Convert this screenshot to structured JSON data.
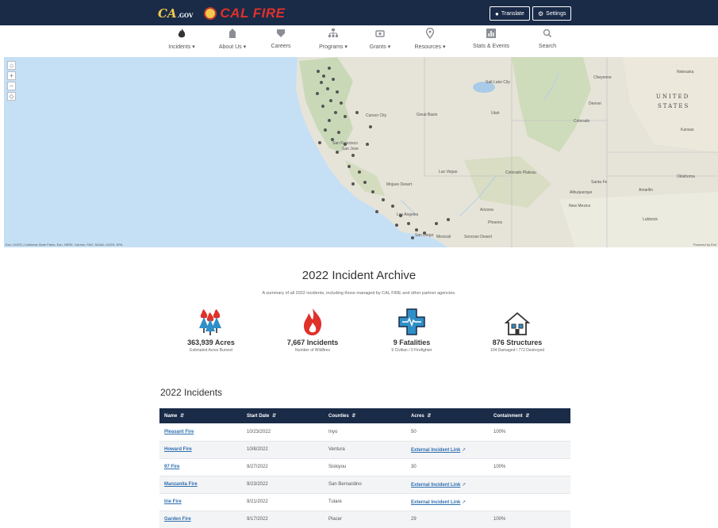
{
  "header": {
    "cagov_logo": "CA",
    "cagov_suffix": ".GOV",
    "brand_name": "CAL FIRE",
    "translate_label": "Translate",
    "settings_label": "Settings"
  },
  "nav": {
    "items": [
      {
        "label": "Incidents",
        "icon": "fire-icon"
      },
      {
        "label": "About Us",
        "icon": "building-icon"
      },
      {
        "label": "Careers",
        "icon": "badge-icon"
      },
      {
        "label": "Programs",
        "icon": "org-chart-icon"
      },
      {
        "label": "Grants",
        "icon": "grants-icon"
      },
      {
        "label": "Resources",
        "icon": "map-pin-icon"
      },
      {
        "label": "Stats & Events",
        "icon": "bar-chart-icon"
      },
      {
        "label": "Search",
        "icon": "search-icon"
      }
    ]
  },
  "map": {
    "labels": {
      "salt_lake_city": "Salt Lake City",
      "cheyenne": "Cheyenne",
      "denver": "Denver",
      "united": "UNITED",
      "states": "STATES",
      "nebraska": "Nebraska",
      "kansas": "Kansas",
      "carson_city": "Carson City",
      "great_basin": "Great Basin",
      "utah": "Utah",
      "colorado": "Colorado",
      "san_francisco": "San Francisco",
      "san_jose": "San Jose",
      "las_vegas": "Las Vegas",
      "colorado_plateau": "Colorado Plateau",
      "santa_fe": "Santa Fe",
      "albuquerque": "Albuquerque",
      "amarillo": "Amarillo",
      "oklahoma": "Oklahoma",
      "mojave_desert": "Mojave Desert",
      "arizona": "Arizona",
      "new_mexico": "New Mexico",
      "phoenix": "Phoenix",
      "lubbock": "Lubbock",
      "los_angeles": "Los Angeles",
      "san_diego": "San Diego",
      "mexicali": "Mexicali",
      "sonoran_desert": "Sonoran Desert"
    },
    "attribution": "Esri, USGS | California State Parks, Esri, HERE, Garmin, FAO, NOAA, USGS, EPA",
    "powered_by": "Powered by Esri"
  },
  "archive": {
    "title": "2022 Incident Archive",
    "subtitle": "A summary of all 2022 incidents, including those managed by CAL FIRE and other partner agencies.",
    "stats": [
      {
        "value": "363,939 Acres",
        "desc": "Estimated Acres Burned",
        "icon": "burning-trees-icon"
      },
      {
        "value": "7,667 Incidents",
        "desc": "Number of Wildfires",
        "icon": "flame-icon"
      },
      {
        "value": "9 Fatalities",
        "desc": "9 Civilian / 0 Firefighter",
        "icon": "medical-cross-icon"
      },
      {
        "value": "876 Structures",
        "desc": "104 Damaged / 772 Destroyed",
        "icon": "house-icon"
      }
    ]
  },
  "incidents": {
    "heading": "2022 Incidents",
    "columns": [
      "Name",
      "Start Date",
      "Counties",
      "Acres",
      "Containment"
    ],
    "rows": [
      {
        "name": "Pleasant Fire",
        "date": "10/23/2022",
        "county": "Inyo",
        "acres": "50",
        "containment": "100%",
        "acres_link": false
      },
      {
        "name": "Howard Fire",
        "date": "10/8/2022",
        "county": "Ventura",
        "acres": "External Incident Link",
        "containment": "",
        "acres_link": true
      },
      {
        "name": "97 Fire",
        "date": "9/27/2022",
        "county": "Siskiyou",
        "acres": "30",
        "containment": "100%",
        "acres_link": false
      },
      {
        "name": "Manzanita Fire",
        "date": "9/23/2022",
        "county": "San Bernardino",
        "acres": "External Incident Link",
        "containment": "",
        "acres_link": true
      },
      {
        "name": "Irie Fire",
        "date": "9/21/2022",
        "county": "Tulare",
        "acres": "External Incident Link",
        "containment": "",
        "acres_link": true
      },
      {
        "name": "Garden Fire",
        "date": "9/17/2022",
        "county": "Placer",
        "acres": "29",
        "containment": "100%",
        "acres_link": false
      }
    ]
  },
  "colors": {
    "navy": "#1a2b48",
    "fire_red": "#e0302a",
    "link_blue": "#2f6fae",
    "medical_blue": "#2f8fc7"
  }
}
